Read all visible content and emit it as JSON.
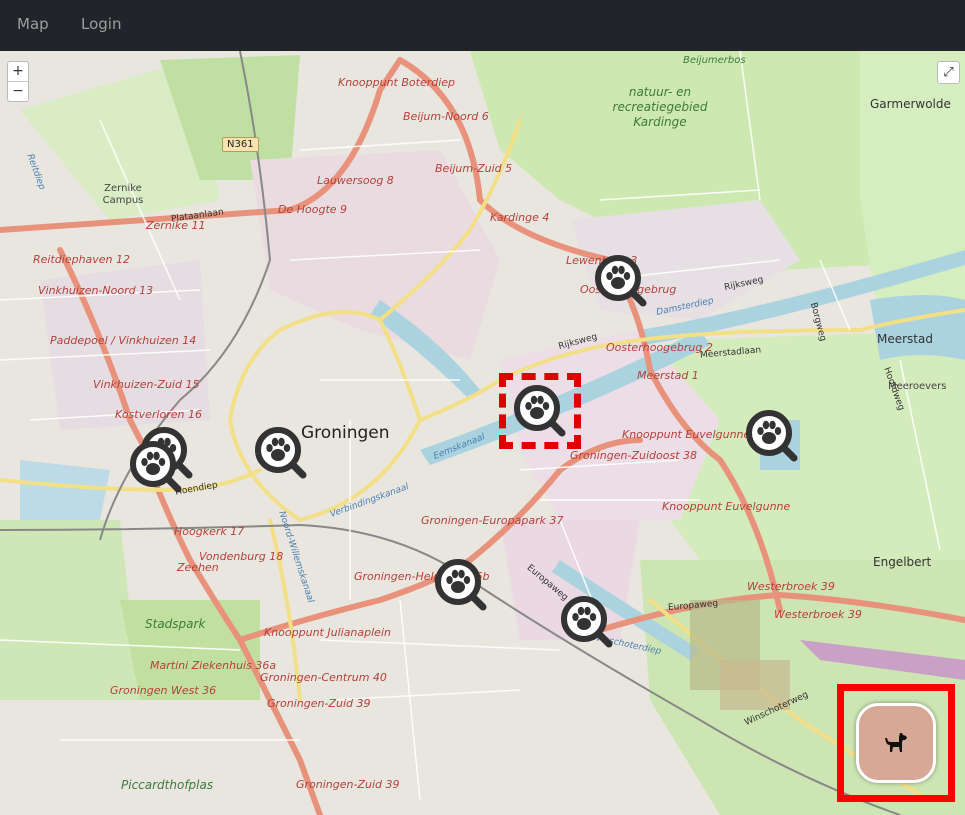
{
  "navbar": {
    "links": [
      {
        "label": "Map"
      },
      {
        "label": "Login"
      }
    ]
  },
  "map_controls": {
    "zoom_in": "+",
    "zoom_out": "−",
    "fullscreen": "⤢"
  },
  "map": {
    "city_label": "Groningen",
    "place_labels": {
      "garmerwolde": "Garmerwolde",
      "meerstad": "Meerstad",
      "meeroevers": "Meeroevers",
      "engelbert": "Engelbert",
      "zernike_campus": "Zernike Campus",
      "stadspark": "Stadspark",
      "piccardthofplas": "Piccardthofplas",
      "beijumerbos": "Beijumerbos",
      "kardinge_park": "natuur- en recreatiegebied Kardinge"
    },
    "junction_labels": {
      "boterdiep": "Knooppunt Boterdiep",
      "beijum_noord": "Beijum-Noord 6",
      "beijum_zuid": "Beijum-Zuid 5",
      "lauwersoog": "Lauwersoog 8",
      "de_hoogte": "De Hoogte 9",
      "kardinge": "Kardinge 4",
      "zernike": "Zernike 11",
      "reitdiephaven": "Reitdiephaven 12",
      "vinkhuizen_noord": "Vinkhuizen-Noord 13",
      "paddepoel": "Paddepoel / Vinkhuizen 14",
      "vinkhuizen_zuid": "Vinkhuizen-Zuid 15",
      "kostverloren": "Kostverloren 16",
      "lewenborg": "Lewenborg 3",
      "oosterhoogebrug_top": "Oosterhoogebrug",
      "oosterhoogebrug": "Oosterhoogebrug 2",
      "meerstad_junction": "Meerstad 1",
      "euvelgunne_top": "Knooppunt Euvelgunne",
      "euvelgunne": "Knooppunt Euvelgunne",
      "zuidoost": "Groningen-Zuidoost 38",
      "europapark": "Groningen-Europapark 37",
      "helpman": "Groningen-Helpman 36b",
      "westerbroek": "Westerbroek 39",
      "westerbroek2": "Westerbroek 39",
      "julianaplein": "Knooppunt Julianaplein",
      "ziekenhuis": "Martini Ziekenhuis 36a",
      "groningen_west": "Groningen West 36",
      "centrum": "Groningen-Centrum 40",
      "zuid": "Groningen-Zuid 39",
      "zuid_bottom": "Groningen-Zuid 39",
      "hoogkerk": "Hoogkerk 17",
      "denburg": "Vondenburg 18",
      "zeehen": "Zeehen"
    },
    "road_labels": {
      "plataanlaan": "Plataanlaan",
      "rijksweg": "Rijksweg",
      "damsterdiep": "Damsterdiep",
      "eemskanaal": "Eemskanaal",
      "verbindingskanaal": "Verbindingskanaal",
      "meerstadlaan": "Meerstadlaan",
      "europaweg": "Europaweg",
      "winschoterweg": "Winschoterweg",
      "hoendiep": "Hoendiep",
      "borgweg": "Borgweg",
      "hoofdweg": "Hoofdweg",
      "noord_willemskanaal": "Noord-Willemskanaal",
      "oude_winschoterdiep": "Oude Winschoterdiep",
      "reitdiep": "Reitdiep"
    },
    "road_shield": "N361",
    "markers": [
      {
        "name": "marker-lewenborg",
        "icon": "paw-search-icon"
      },
      {
        "name": "marker-eemskanaal",
        "icon": "paw-search-icon",
        "selected": true
      },
      {
        "name": "marker-euvelgunne",
        "icon": "paw-search-icon"
      },
      {
        "name": "marker-centrum-west",
        "icon": "paw-search-icon"
      },
      {
        "name": "marker-vinkhuizen-a",
        "icon": "paw-search-icon"
      },
      {
        "name": "marker-vinkhuizen-b",
        "icon": "paw-search-icon"
      },
      {
        "name": "marker-helpman",
        "icon": "paw-search-icon"
      },
      {
        "name": "marker-europaweg",
        "icon": "paw-search-icon"
      }
    ]
  },
  "dog_button": {
    "icon": "dog-icon",
    "highlight": "#ff0000",
    "bg": "#d8a896"
  }
}
